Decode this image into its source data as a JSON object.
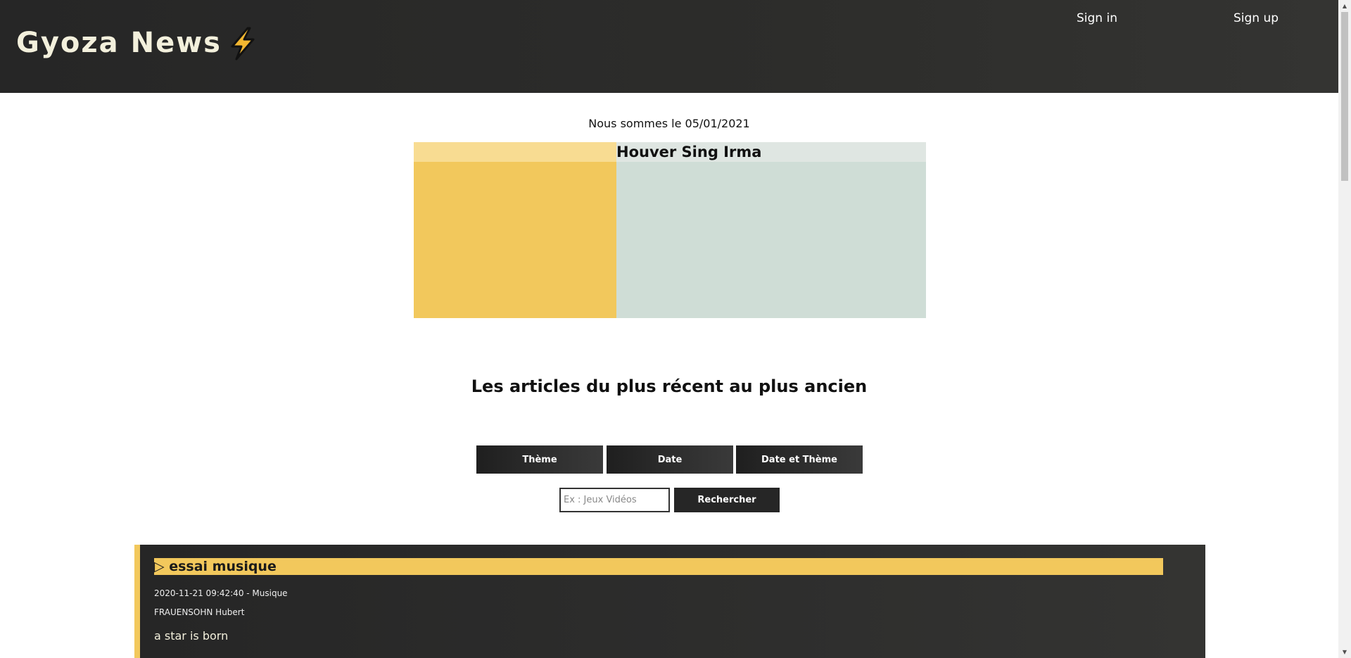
{
  "header": {
    "logo_text": "Gyoza News",
    "logo_icon": "lightning-bolt-icon",
    "nav": {
      "sign_in": "Sign in",
      "sign_up": "Sign up"
    }
  },
  "date_line": "Nous sommes le 05/01/2021",
  "featured": {
    "title": "Houver Sing Irma"
  },
  "section_title": "Les articles du plus récent au plus ancien",
  "filters": {
    "theme": "Thème",
    "date": "Date",
    "date_theme": "Date et Thème"
  },
  "search": {
    "placeholder": "Ex : Jeux Vidéos",
    "button": "Rechercher"
  },
  "articles": [
    {
      "title": "▷ essai musique",
      "meta": "2020-11-21 09:42:40 - Musique",
      "author": "FRAUENSOHN Hubert",
      "body": "a star is born"
    }
  ],
  "colors": {
    "header_bg": "#2d2d2b",
    "accent_yellow": "#f2c85c",
    "sage": "#cfddd6",
    "logo_text": "#f3f0dc"
  }
}
